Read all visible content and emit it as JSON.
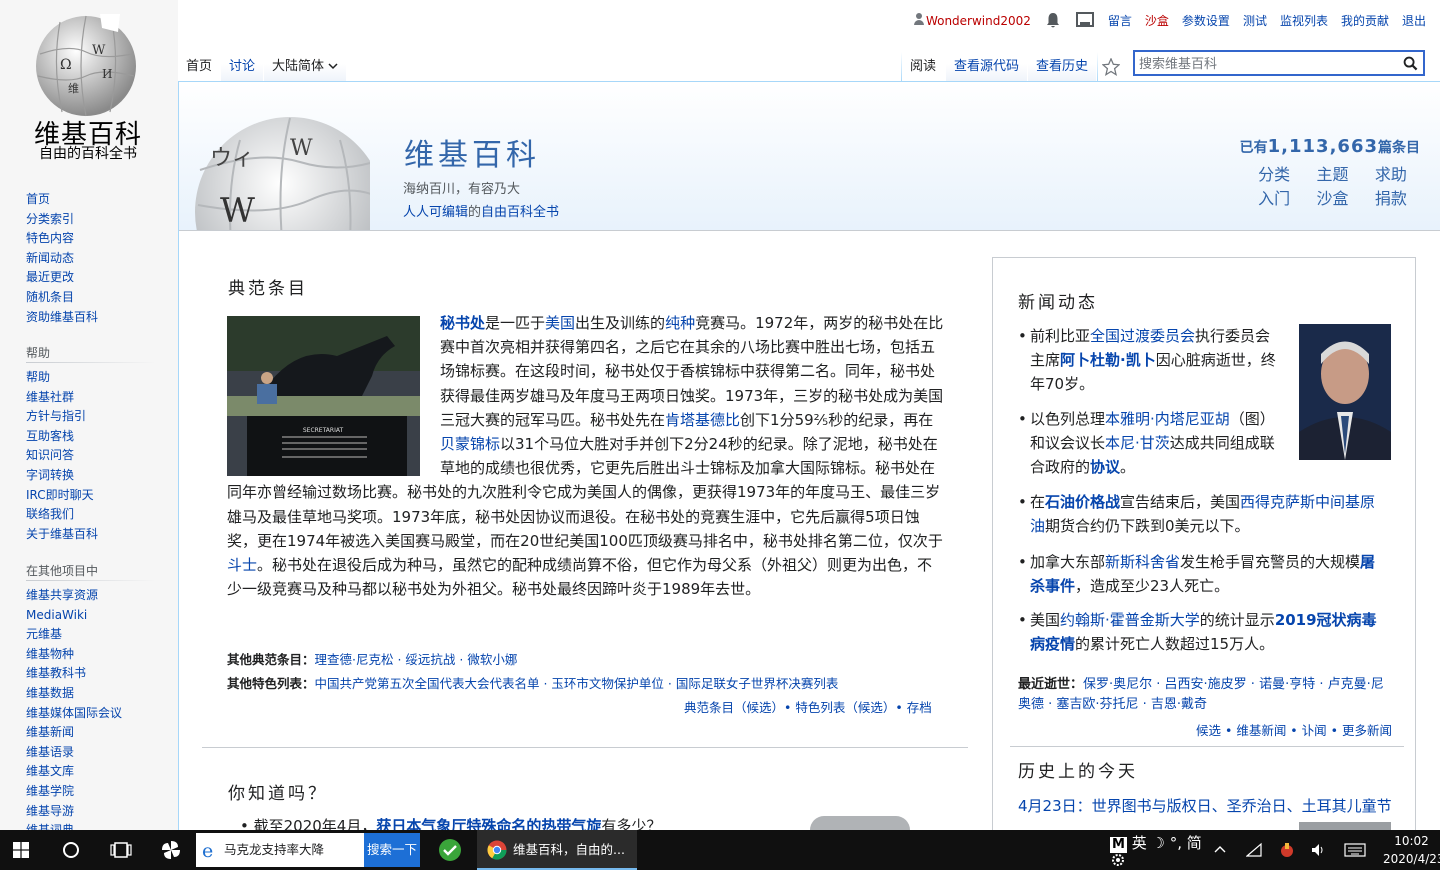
{
  "sidebar": {
    "logo_title": "维基百科",
    "logo_sub": "自由的百科全书",
    "nav1": [
      "首页",
      "分类索引",
      "特色内容",
      "新闻动态",
      "最近更改",
      "随机条目",
      "资助维基百科"
    ],
    "help_heading": "帮助",
    "nav2": [
      "帮助",
      "维基社群",
      "方针与指引",
      "互助客栈",
      "知识问答",
      "字词转换",
      "IRC即时聊天",
      "联络我们",
      "关于维基百科"
    ],
    "other_heading": "在其他项目中",
    "nav3": [
      "维基共享资源",
      "MediaWiki",
      "元维基",
      "维基物种",
      "维基教科书",
      "维基数据",
      "维基媒体国际会议",
      "维基新闻",
      "维基语录",
      "维基文库",
      "维基学院",
      "维基导游",
      "维基词典"
    ]
  },
  "personal": {
    "username": "Wonderwind2002",
    "links": [
      "留言",
      "沙盒",
      "参数设置",
      "测试",
      "监视列表",
      "我的贡献",
      "退出"
    ]
  },
  "tabs": {
    "left": [
      "首页",
      "讨论",
      "大陆简体"
    ],
    "right": [
      "阅读",
      "查看源代码",
      "查看历史"
    ]
  },
  "search": {
    "placeholder": "搜索维基百科"
  },
  "banner": {
    "title": "维基百科",
    "sub1": "海纳百川，有容乃大",
    "sub2_link1": "人人可编辑",
    "sub2_mid": "的",
    "sub2_link2": "自由百科全书",
    "count_prefix": "已有",
    "count": "1,113,663",
    "count_suffix": "篇条目",
    "portals": [
      "分类",
      "主题",
      "求助",
      "入门",
      "沙盒",
      "捐款"
    ]
  },
  "featured": {
    "heading": "典范条目",
    "image_caption": "SECRETARIAT",
    "other_featured_label": "其他典范条目：",
    "other_featured": "理查德·尼克松 · 绥远抗战 · 微软小娜",
    "other_lists_label": "其他特色列表：",
    "other_lists": "中国共产党第五次全国代表大会代表名单 · 玉环市文物保护单位 · 国际足联女子世界杯决赛列表",
    "archive": "典范条目（候选）• 特色列表（候选）• 存档"
  },
  "dyk": {
    "heading": "你知道吗？",
    "item_prefix": "截至2020年4月，",
    "item_link": "获日本气象厅特殊命名的热带气旋",
    "item_suffix": "有多少？"
  },
  "news": {
    "heading": "新闻动态",
    "recent_deaths_label": "最近逝世：",
    "recent_deaths": "保罗·奥尼尔 · 吕西安·施皮罗 · 诺曼·亨特 · 卢克曼·尼奥德 · 塞吉欧·芬托尼 · 吉恩·戴奇",
    "footer": "候选 • 维基新闻 • 讣闻 • 更多新闻"
  },
  "otd": {
    "heading": "历史上的今天",
    "date_line": "4月23日：世界图书与版权日、圣乔治日、土耳其儿童节"
  },
  "taskbar": {
    "ie_search": "马克龙支持率大降",
    "search_btn": "搜索一下",
    "chrome_title": "维基百科，自由的...",
    "ime": "英 ☽ °, 简",
    "time": "10:02",
    "date": "2020/4/23"
  }
}
